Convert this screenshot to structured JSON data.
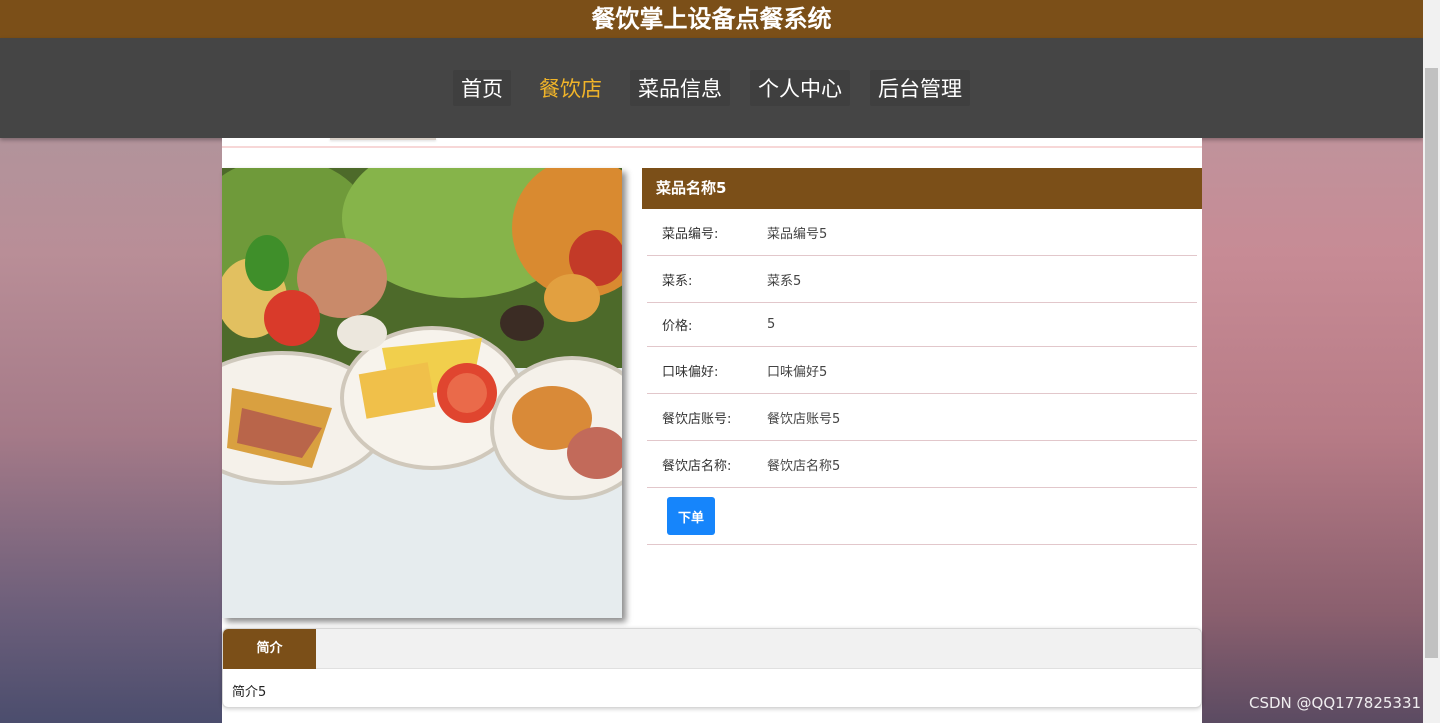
{
  "header": {
    "title": "餐饮掌上设备点餐系统"
  },
  "nav": [
    {
      "label": "首页"
    },
    {
      "label": "餐饮店"
    },
    {
      "label": "菜品信息"
    },
    {
      "label": "个人中心"
    },
    {
      "label": "后台管理"
    }
  ],
  "nav_active": "餐饮店",
  "detail": {
    "name": "菜品名称5",
    "rows": [
      {
        "label": "菜品编号:",
        "value": "菜品编号5"
      },
      {
        "label": "菜系:",
        "value": "菜系5"
      },
      {
        "label": "价格:",
        "value": "5"
      },
      {
        "label": "口味偏好:",
        "value": "口味偏好5"
      },
      {
        "label": "餐饮店账号:",
        "value": "餐饮店账号5"
      },
      {
        "label": "餐饮店名称:",
        "value": "餐饮店名称5"
      }
    ],
    "order_label": "下单"
  },
  "tabs": {
    "tab_label": "简介",
    "content": "简介5"
  },
  "watermark": "CSDN @QQ177825331",
  "colors": {
    "brand": "#7b4f18",
    "nav_bg": "#454545",
    "active_nav": "#f0b429",
    "button": "#1685fb"
  }
}
